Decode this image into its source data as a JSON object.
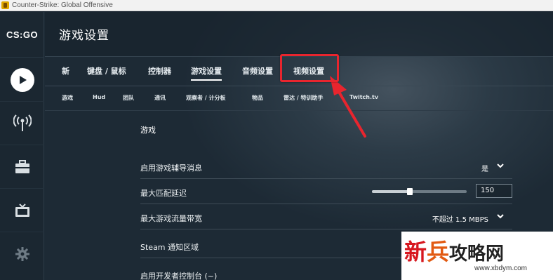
{
  "window": {
    "title": "Counter-Strike: Global Offensive"
  },
  "logo": {
    "text": "CS:GO"
  },
  "header": {
    "title": "游戏设置"
  },
  "tabs": [
    {
      "label": "新"
    },
    {
      "label": "键盘 / 鼠标"
    },
    {
      "label": "控制器"
    },
    {
      "label": "游戏设置",
      "active": true
    },
    {
      "label": "音频设置"
    },
    {
      "label": "视频设置"
    }
  ],
  "subtabs": [
    {
      "label": "游戏"
    },
    {
      "label": "Hud"
    },
    {
      "label": "团队"
    },
    {
      "label": "通讯"
    },
    {
      "label": "观察者 / 计分板"
    },
    {
      "label": "物品"
    },
    {
      "label": "雷达 / 特训助手"
    },
    {
      "label": "Twitch.tv"
    }
  ],
  "section": {
    "title": "游戏"
  },
  "settings": [
    {
      "label": "启用游戏辅导消息",
      "value": "是"
    },
    {
      "label": "最大匹配延迟",
      "value": "150",
      "slider_fraction": 0.4
    },
    {
      "label": "最大游戏流量带宽",
      "value": "不超过 1.5 MBPS"
    },
    {
      "label": "Steam 通知区域"
    },
    {
      "label": "启用开发者控制台 (~)"
    }
  ],
  "watermark": {
    "c1": "新",
    "c2": "兵",
    "c3": "攻略网",
    "url": "www.xbdym.com"
  },
  "colors": {
    "highlight": "#e8252e",
    "accent_white": "#ffffff"
  },
  "icons": [
    "play-icon",
    "broadcast-icon",
    "briefcase-icon",
    "tv-icon",
    "gear-icon",
    "chevron-down-icon",
    "arrow-pointer-icon"
  ]
}
